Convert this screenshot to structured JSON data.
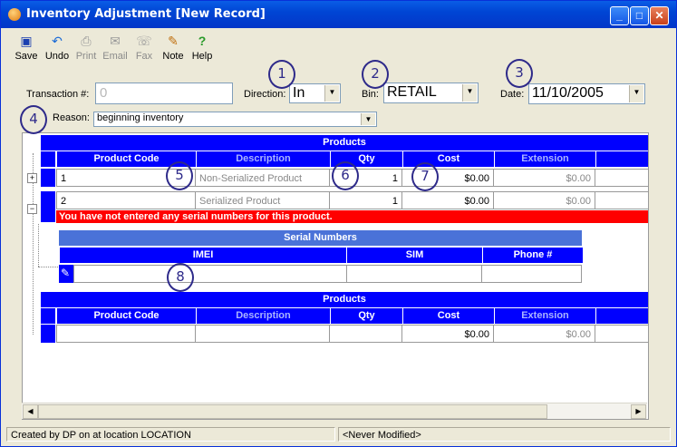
{
  "window": {
    "title": "Inventory Adjustment [New Record]",
    "buttons": {
      "minimize": "_",
      "maximize": "□",
      "close": "✕"
    }
  },
  "toolbar": {
    "save": "Save",
    "undo": "Undo",
    "print": "Print",
    "email": "Email",
    "fax": "Fax",
    "note": "Note",
    "help": "Help"
  },
  "form": {
    "transaction_label": "Transaction #:",
    "transaction_value": "0",
    "direction_label": "Direction:",
    "direction_value": "In",
    "bin_label": "Bin:",
    "bin_value": "RETAIL",
    "date_label": "Date:",
    "date_value": "11/10/2005",
    "reason_label": "Reason:",
    "reason_value": "beginning inventory"
  },
  "callouts": [
    "1",
    "2",
    "3",
    "4",
    "5",
    "6",
    "7",
    "8"
  ],
  "products": {
    "header": "Products",
    "columns": [
      "Product Code",
      "Description",
      "Qty",
      "Cost",
      "Extension"
    ],
    "rows": [
      {
        "expand": "+",
        "code": "1",
        "description": "Non-Serialized Product",
        "qty": "1",
        "cost": "$0.00",
        "extension": "$0.00"
      },
      {
        "expand": "−",
        "code": "2",
        "description": "Serialized Product",
        "qty": "1",
        "cost": "$0.00",
        "extension": "$0.00"
      }
    ],
    "error": "You have not entered any serial numbers for this product."
  },
  "serials": {
    "header": "Serial Numbers",
    "columns": [
      "IMEI",
      "SIM",
      "Phone #"
    ]
  },
  "products_new": {
    "header": "Products",
    "columns": [
      "Product Code",
      "Description",
      "Qty",
      "Cost",
      "Extension"
    ],
    "row": {
      "cost": "$0.00",
      "extension": "$0.00"
    }
  },
  "status": {
    "created": "Created by DP on  at location LOCATION",
    "modified": "<Never Modified>"
  },
  "colors": {
    "grid_blue": "#0000ff",
    "error_red": "#ff0000",
    "title_blue": "#0045d4"
  }
}
